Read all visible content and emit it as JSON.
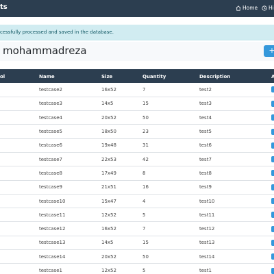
{
  "navbar": {
    "brand": "ts",
    "home_label": "Home",
    "history_label": "His"
  },
  "alert": {
    "message": "cessfully processed and saved in the database."
  },
  "header": {
    "title": " mohammadreza",
    "add_button_label": "+"
  },
  "table": {
    "columns": [
      "ol",
      "Name",
      "Size",
      "Quantity",
      "Description",
      "A"
    ],
    "rows": [
      {
        "name": "testcase2",
        "size": "16x52",
        "quantity": "7",
        "description": "test2"
      },
      {
        "name": "testcase3",
        "size": "14x5",
        "quantity": "15",
        "description": "test3"
      },
      {
        "name": "testcase4",
        "size": "20x52",
        "quantity": "50",
        "description": "test4"
      },
      {
        "name": "testcase5",
        "size": "18x50",
        "quantity": "23",
        "description": "test5"
      },
      {
        "name": "testcase6",
        "size": "19x48",
        "quantity": "31",
        "description": "test6"
      },
      {
        "name": "testcase7",
        "size": "22x53",
        "quantity": "42",
        "description": "test7"
      },
      {
        "name": "testcase8",
        "size": "17x49",
        "quantity": "8",
        "description": "test8"
      },
      {
        "name": "testcase9",
        "size": "21x51",
        "quantity": "16",
        "description": "test9"
      },
      {
        "name": "testcase10",
        "size": "15x47",
        "quantity": "4",
        "description": "test10"
      },
      {
        "name": "testcase11",
        "size": "12x52",
        "quantity": "5",
        "description": "test11"
      },
      {
        "name": "testcase12",
        "size": "16x52",
        "quantity": "7",
        "description": "test12"
      },
      {
        "name": "testcase13",
        "size": "14x5",
        "quantity": "15",
        "description": "test13"
      },
      {
        "name": "testcase14",
        "size": "20x52",
        "quantity": "50",
        "description": "test14"
      },
      {
        "name": "testcase1",
        "size": "12x52",
        "quantity": "5",
        "description": "test1"
      }
    ]
  },
  "colors": {
    "navbar_bg": "#2c3e50",
    "alert_bg": "#d1ecf1",
    "accent_button": "#3498db"
  },
  "icons": {
    "home": "home-icon",
    "history": "history-icon",
    "action": "action-button"
  }
}
